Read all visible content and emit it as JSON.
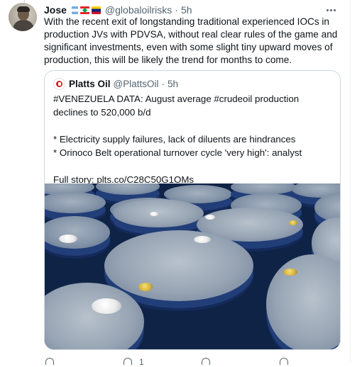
{
  "tweet": {
    "author_name": "Jose",
    "flags": [
      "flag-argentina",
      "flag-lebanon",
      "flag-venezuela"
    ],
    "handle": "@globaloilrisks",
    "separator": "·",
    "time": "5h",
    "text": "With the recent exit of longstanding traditional experienced IOCs in production JVs with PDVSA, without real clear rules of the game and significant investments, even with some slight tiny upward moves of production, this will be likely the trend for months to come."
  },
  "quote": {
    "author_name": "Platts Oil",
    "handle": "@PlattsOil",
    "separator": "·",
    "time": "5h",
    "lines": [
      "#VENEZUELA DATA: August average #crudeoil production declines to 520,000 b/d",
      "* Electricity supply failures, lack of diluents are hindrances",
      "* Orinoco Belt operational turnover cycle 'very high': analyst",
      "Full story: plts.co/C28C50G1OMs"
    ],
    "image_icon": "oil-drums-photo"
  },
  "actions": {
    "reply_icon": "reply-icon",
    "retweet_count": "1",
    "like_icon": "like-icon",
    "share_icon": "share-icon"
  },
  "colors": {
    "text": "#0f1419",
    "secondary": "#536471",
    "border": "#cfd9de",
    "drum_blue": "#223e78"
  }
}
